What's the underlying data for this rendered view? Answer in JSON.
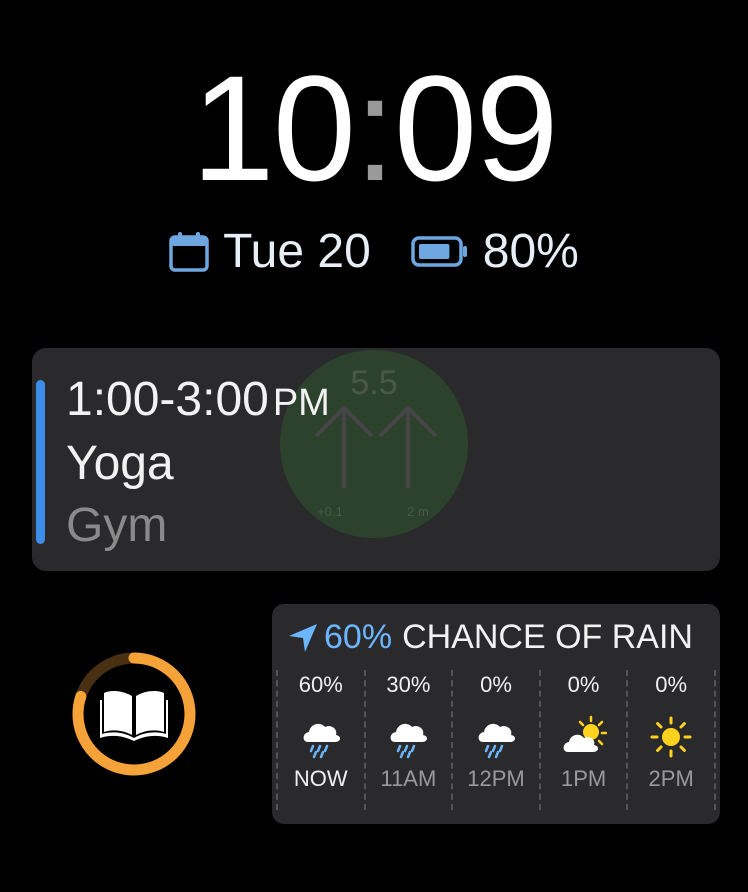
{
  "clock": {
    "hours": "10",
    "separator": ":",
    "minutes": "09"
  },
  "status": {
    "date_icon": "calendar-icon",
    "date": "Tue 20",
    "battery_icon": "battery-icon",
    "battery": "80%",
    "battery_level_fraction": 0.8,
    "accent_color": "#6ea7e0"
  },
  "event": {
    "time": "1:00-3:00",
    "ampm": "PM",
    "title": "Yoga",
    "location": "Gym",
    "bar_color": "#3d8ee8",
    "overlay": {
      "value": "5.5",
      "left_label": "+0.1",
      "right_label": "2 m"
    }
  },
  "book_complication": {
    "icon": "book-open-icon",
    "ring_color": "#f5a238",
    "progress_fraction": 0.8
  },
  "weather": {
    "header_icon": "location-arrow-icon",
    "chance": "60%",
    "label": "CHANCE OF RAIN",
    "hours": [
      {
        "pct": "60%",
        "icon": "rain-cloud-icon",
        "time": "NOW"
      },
      {
        "pct": "30%",
        "icon": "rain-cloud-icon",
        "time": "11AM"
      },
      {
        "pct": "0%",
        "icon": "rain-cloud-icon",
        "time": "12PM"
      },
      {
        "pct": "0%",
        "icon": "partly-sunny-icon",
        "time": "1PM"
      },
      {
        "pct": "0%",
        "icon": "sun-icon",
        "time": "2PM"
      }
    ]
  }
}
